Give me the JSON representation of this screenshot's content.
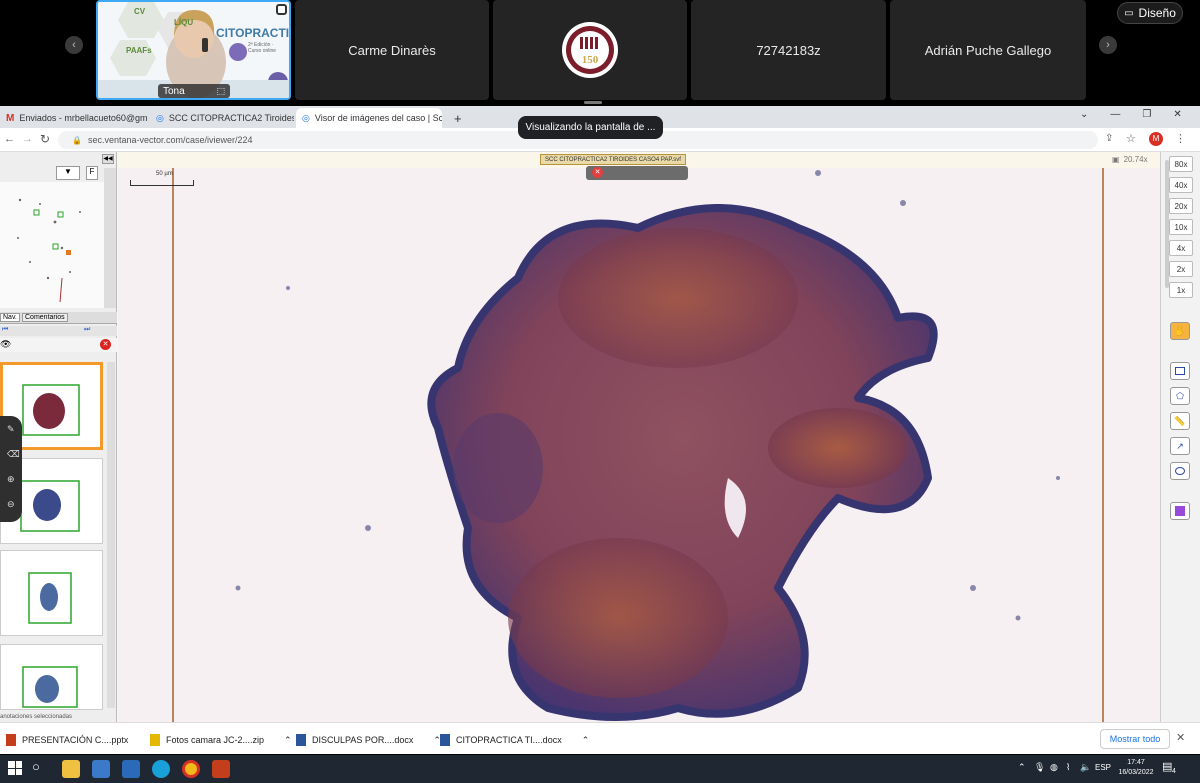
{
  "meeting": {
    "speaker_name": "Tona",
    "participants": [
      "Carme Dinarès",
      "72742183z",
      "Adrián Puche Gallego"
    ],
    "design_button": "Diseño",
    "screen_share_banner": "Visualizando la pantalla de ...",
    "slide": {
      "title": "CITOPRACTICA",
      "subtitle": "2ª Edición · Curso online",
      "label_cv": "CV",
      "label_paafs": "PAAFs",
      "label_liquid": "LÍQU"
    },
    "seal_text": "150"
  },
  "browser": {
    "tabs": [
      {
        "label": "Enviados - mrbellacueto60@gm..."
      },
      {
        "label": "SCC CITOPRACTICA2 Tiroides Ca..."
      },
      {
        "label": "Visor de imágenes del caso | Sc..."
      }
    ],
    "url": "sec.ventana-vector.com/case/iviewer/224",
    "profile_initial": "M"
  },
  "viewer": {
    "case_title": "SCC CITOPRACTICA2 TIROIDES CASO4 PAP.svf",
    "zoom_readout": "20.74x",
    "scale_bar_label": "50 µm",
    "zoom_levels": [
      "80x",
      "40x",
      "20x",
      "10x",
      "4x",
      "2x",
      "1x"
    ],
    "left_tabs": [
      "Nav.",
      "Comentarios"
    ],
    "footer_text": "anotaciones seleccionadas"
  },
  "downloads": {
    "items": [
      {
        "name": "PRESENTACIÓN C....pptx",
        "color": "#c43e1c"
      },
      {
        "name": "Fotos camara JC-2....zip",
        "color": "#e5b800"
      },
      {
        "name": "DISCULPAS POR....docx",
        "color": "#2b579a"
      },
      {
        "name": "CITOPRACTICA TI....docx",
        "color": "#2b579a"
      }
    ],
    "show_all": "Mostrar todo"
  },
  "taskbar": {
    "language": "ESP",
    "time": "17:47",
    "date": "16/03/2022",
    "notifications": "4"
  }
}
